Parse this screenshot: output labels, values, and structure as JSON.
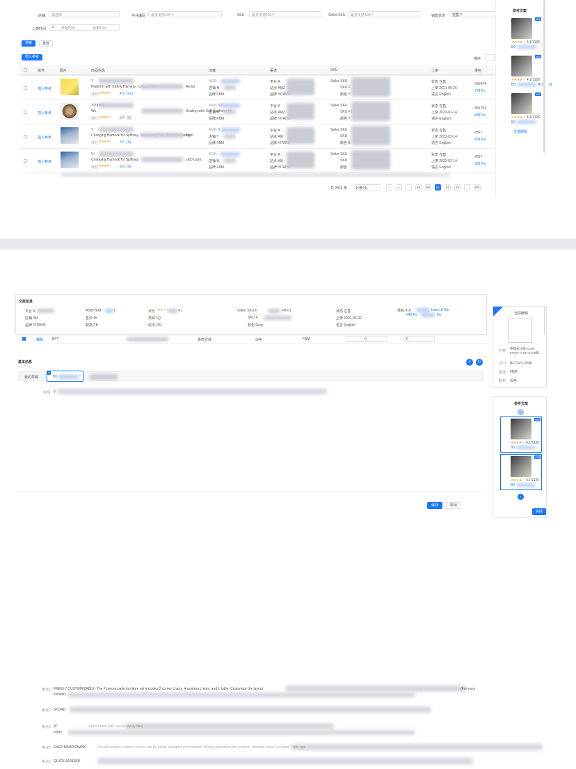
{
  "filters": {
    "shop_label": "店铺",
    "shop_placeholder": "请选择",
    "platform_code_label": "平台编码",
    "platform_code_placeholder": "最多支持100个",
    "sku_label": "SKU",
    "sku_placeholder": "最多支持100个",
    "seller_sku_label": "Seller SKU",
    "seller_sku_placeholder": "最多支持100个",
    "sale_status_label": "销售状态",
    "sale_status_value": "在售",
    "shelf_time_label": "上架时间",
    "start_date_placeholder": "开始时间",
    "end_date_placeholder": "结束时间",
    "search_btn": "搜索",
    "reset_btn": "重置"
  },
  "toolbar": {
    "insert_ref_btn": "插入参考",
    "sort_label": "排序"
  },
  "table": {
    "headers": [
      "操作",
      "图片",
      "商品信息",
      "前端",
      "渠道",
      "SKU",
      "上架",
      "排名"
    ],
    "rows": [
      {
        "action": "插入参考",
        "title_a": "Y",
        "title_b": "Platform with Safety Harness, Collapsible Li",
        "title_c": "Aerial",
        "rating_label": "评分",
        "rating": "4.3",
        "reviews": "(22)",
        "col_front_1": "ASIN",
        "col_front_2": "店铺 M",
        "col_front_3": "品牌 FBM",
        "col_ch_1": "平台 A",
        "col_ch_2": "站点 AMZ",
        "col_ch_3": "品牌 YITAHO",
        "col_sku_1": "Seller SKU",
        "col_sku_2": "SKU F",
        "col_sku_3": "颜色 Y",
        "st_status": "状态 在售",
        "st_date": "上架 2021-09-26",
        "st_lang": "语言 English",
        "rank_1": "#50474",
        "rank_2": "#78 Fo"
      },
      {
        "action": "插入参考",
        "title_a": "YITAHO",
        "title_b": "We",
        "title_c": "Seating with Soft Cushions for",
        "rating_label": "评分",
        "rating": "3.4",
        "reviews": "(3)",
        "col_front_1": "ASIN B0",
        "col_front_2": "店铺 M",
        "col_front_3": "品牌 FBM",
        "col_ch_1": "平台 A",
        "col_ch_2": "站点 AMZ",
        "col_ch_3": "品牌 YITAHO",
        "col_sku_1": "Seller SKU",
        "col_sku_2": "SKU FT",
        "col_sku_3": "颜色 Y",
        "st_status": "状态 在售",
        "st_date": "上架 2023-01-14",
        "st_lang": "语言 English",
        "rank_1": "#56791",
        "rank_2": "#59 Pa"
      },
      {
        "action": "插入参考",
        "title_a": "Y",
        "title_b": "Changing Hamock for Spillway, Swimming Pool, Outdoor Garden",
        "title_c": "Light",
        "rating_label": "评分",
        "rating": "3.6",
        "reviews": "(9)",
        "col_front_1": "ASIN B",
        "col_front_2": "店铺 Y",
        "col_front_3": "品牌 FBM",
        "col_ch_1": "平台 A",
        "col_ch_2": "站点 AM",
        "col_ch_3": "品牌 YITAHO",
        "col_sku_1": "Seller SKU",
        "col_sku_2": "SKU",
        "col_sku_3": "颜色 B",
        "st_status": "状态 在售",
        "st_date": "上架 2023-02-14",
        "st_lang": "语言 English",
        "rank_1": "#567",
        "rank_2": "#59 Pa"
      },
      {
        "action": "插入参考",
        "title_a": "YI",
        "title_b": "Changing Hamock for Spillway,",
        "title_c": "LED Light",
        "rating_label": "评分",
        "rating": "3.6",
        "reviews": "(9)",
        "col_front_1": "ASIN",
        "col_front_2": "店铺 M",
        "col_front_3": "品牌 FBM",
        "col_ch_1": "平台 A",
        "col_ch_2": "站点 AM",
        "col_ch_3": "品牌 YITAHO",
        "col_sku_1": "Seller SKU",
        "col_sku_2": "SKU",
        "col_sku_3": "颜色",
        "st_status": "状态 在售",
        "st_date": "上架 2023-02-14",
        "st_lang": "语言 English",
        "rank_1": "#567",
        "rank_2": "#59 Pa"
      }
    ]
  },
  "pagination": {
    "total": "共 2816 条",
    "per_page": "10条/页",
    "pages": [
      "1",
      "...",
      "49",
      "50",
      "51",
      "52",
      "53",
      "...",
      "282"
    ],
    "active": "51"
  },
  "ref_panel_top": {
    "title": "参考文案",
    "items": [
      {
        "badge": "#40",
        "rating": "4.1/1126",
        "code": "B0"
      },
      {
        "badge": "#40",
        "rating": "4.1/1126",
        "code": "B0",
        "code_tail": "ATQ",
        "extra": "@"
      },
      {
        "badge": "#40",
        "rating": "4.1/1126",
        "code": "B0"
      }
    ],
    "load_all": "全部删除"
  },
  "detail": {
    "section_title": "文案信息",
    "info": {
      "platform": "平台 A",
      "shop": "店铺 AM",
      "brand": "品牌 YITAHO",
      "asin": "ASIN B0B",
      "asin_tail": "T",
      "price": "售价 ¥5",
      "delivery": "配送 FB",
      "score_label": "评分",
      "score": "4.1",
      "category": "类目 1Q",
      "site": "站点 US",
      "seller_sku": "Seller SKU F",
      "seller_sku_tail": "FB-01",
      "sku": "SKU F",
      "color": "颜色 Grey",
      "status": "状态 在售",
      "shelf": "上架 2021-06-22",
      "lang": "语言 English",
      "rank_label": "排名 #16",
      "rank_tail": "Lawn & Ga",
      "rank_2": "#40 Pa",
      "rank_2_tail": "itio"
    },
    "selected_row": {
      "action": "编辑",
      "code": "BFT",
      "col_a": "系统合成",
      "col_b": "白色",
      "col_c": "FBM",
      "qty_a": "0",
      "qty_b": "0"
    },
    "basic_title": "基本信息",
    "my_draft": "我的草稿",
    "draft_chip": "B0",
    "title_label": "标题",
    "title_val": "Y",
    "bullets": [
      {
        "label": "卖点1",
        "text": "FREELY CUSTOMIZABLE: The 7 pieces patio furniture set includes 2 corner chairs, 4 armless chairs, and 1 table. Customize the layout",
        "tail": "(For easy",
        "line2": "installat"
      },
      {
        "label": "卖点2",
        "text": "STURD",
        "tail": ""
      },
      {
        "label": "卖点3",
        "text": "W",
        "mid": "proof rattan with classic steely fiber",
        "line2": "enjoy"
      },
      {
        "label": "卖点4",
        "text": "EASY MAINTENANC",
        "mid": "Our all-weather cushion covers can be easily unzipped and cleaned. Simply wipe down the weather-resistant wicker to clean. Table top"
      },
      {
        "label": "卖点5",
        "text": "QUICK ASSEMB"
      }
    ],
    "save_btn": "保存",
    "cancel_btn": "取消"
  },
  "current_edit": {
    "badge": "当前编辑",
    "title": "当前编辑",
    "name": "英雄式沙发+CHH-5704T+CHH-5173梯...",
    "name_label": "名称",
    "sku_label": "SKU",
    "sku": "BFTLPT-200B",
    "delivery_label": "配送",
    "delivery": "FBM",
    "color_label": "颜色",
    "color": "白色"
  },
  "ref_panel_bottom": {
    "title": "参考文案",
    "items": [
      {
        "badge": "#40",
        "rating": "4.1/1126",
        "code": "B0"
      },
      {
        "badge": "#40",
        "rating": "4.1/1126",
        "code": "B0"
      }
    ],
    "confirm_btn": "完成"
  },
  "colors": {
    "accent": "#1677ff",
    "star": "#f5a623",
    "border": "#dcdfe6"
  }
}
